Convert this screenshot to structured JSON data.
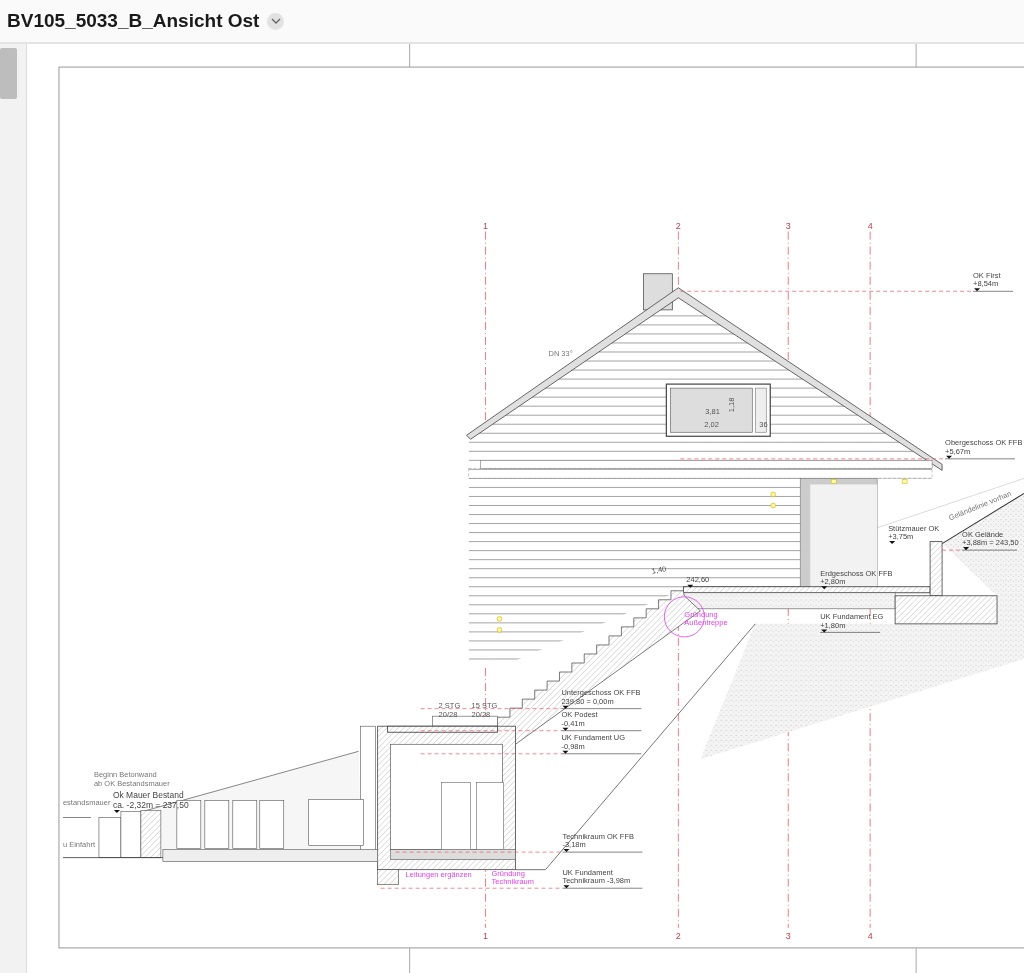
{
  "document": {
    "title": "BV105_5033_B_Ansicht Ost"
  },
  "drawing": {
    "grid_axes_top": [
      {
        "label": "1"
      },
      {
        "label": "2"
      },
      {
        "label": "3"
      },
      {
        "label": "4"
      }
    ],
    "grid_axes_bottom": [
      {
        "label": "1"
      },
      {
        "label": "2"
      },
      {
        "label": "3"
      },
      {
        "label": "4"
      }
    ],
    "labels": [
      {
        "kind": "level",
        "lines": [
          "OK First",
          "+8,54m"
        ]
      },
      {
        "kind": "annotation",
        "lines": [
          "DN 33°"
        ]
      },
      {
        "kind": "dimension",
        "lines": [
          "1,18"
        ]
      },
      {
        "kind": "dimension",
        "lines": [
          "3,81"
        ]
      },
      {
        "kind": "dimension",
        "lines": [
          "2,02"
        ]
      },
      {
        "kind": "dimension",
        "lines": [
          "36"
        ]
      },
      {
        "kind": "level",
        "lines": [
          "Obergeschoss OK FFB",
          "+5,67m"
        ]
      },
      {
        "kind": "annotation",
        "lines": [
          "Geländelinie vorhan"
        ]
      },
      {
        "kind": "level",
        "lines": [
          "Stützmauer OK",
          "+3,75m"
        ]
      },
      {
        "kind": "level",
        "lines": [
          "OK Gelände",
          "+3,88m = 243,50"
        ]
      },
      {
        "kind": "dimension",
        "lines": [
          "1,40"
        ]
      },
      {
        "kind": "level",
        "lines": [
          "242,60"
        ]
      },
      {
        "kind": "level",
        "lines": [
          "Erdgeschoss OK FFB",
          "+2,80m"
        ]
      },
      {
        "kind": "note",
        "lines": [
          "Gründung",
          "Außentreppe"
        ]
      },
      {
        "kind": "level",
        "lines": [
          "UK Fundament EG",
          "+1,80m"
        ]
      },
      {
        "kind": "dimension",
        "lines": [
          "2 STG",
          "20/28"
        ]
      },
      {
        "kind": "dimension",
        "lines": [
          "15 STG",
          "20/28"
        ]
      },
      {
        "kind": "level",
        "lines": [
          "Untergeschoss OK FFB",
          "239,80 = 0,00m"
        ]
      },
      {
        "kind": "level",
        "lines": [
          "OK Podest",
          "-0,41m"
        ]
      },
      {
        "kind": "level",
        "lines": [
          "UK Fundament UG",
          "-0,98m"
        ]
      },
      {
        "kind": "annotation",
        "lines": [
          "Beginn Betonwand",
          "ab OK Bestandsmauer"
        ]
      },
      {
        "kind": "annotation",
        "lines": [
          "estandsmauer"
        ]
      },
      {
        "kind": "level",
        "lines": [
          "Ok Mauer Bestand",
          "ca. -2,32m = 237,50"
        ]
      },
      {
        "kind": "annotation",
        "lines": [
          "u Einfahrt"
        ]
      },
      {
        "kind": "level",
        "lines": [
          "Technikraum OK FFB",
          "-3,18m"
        ]
      },
      {
        "kind": "note",
        "lines": [
          "Leitungen ergänzen"
        ]
      },
      {
        "kind": "note",
        "lines": [
          "Gründung",
          "Technikraum"
        ]
      },
      {
        "kind": "level",
        "lines": [
          "UK Fundament",
          "Technikraum -3,98m"
        ]
      }
    ]
  }
}
